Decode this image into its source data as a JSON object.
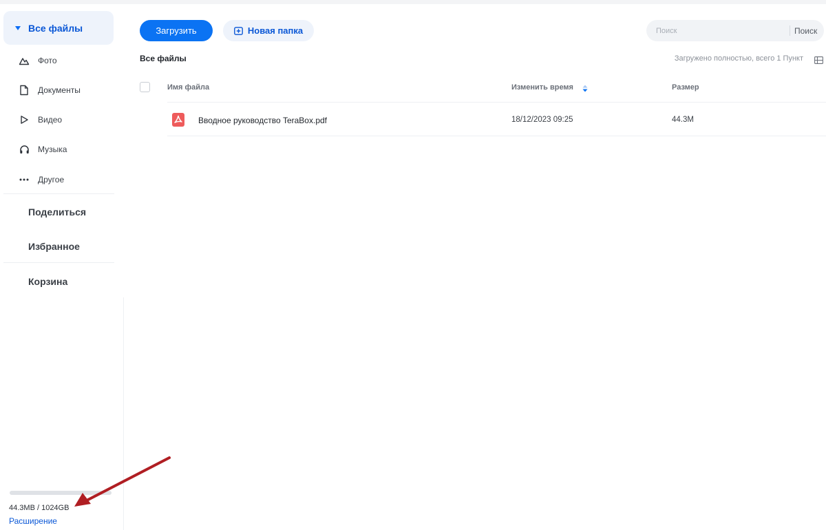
{
  "sidebar": {
    "active_item": "Все файлы",
    "sub_items": [
      {
        "label": "Фото",
        "icon": "mountain-photo-icon"
      },
      {
        "label": "Документы",
        "icon": "document-icon"
      },
      {
        "label": "Видео",
        "icon": "play-icon"
      },
      {
        "label": "Музыка",
        "icon": "headphones-icon"
      },
      {
        "label": "Другое",
        "icon": "more-dots-icon"
      }
    ],
    "main_items": [
      "Поделиться",
      "Избранное",
      "Корзина"
    ],
    "storage": {
      "text": "44.3MB / 1024GB",
      "used_fraction": 4e-05
    },
    "expand_label": "Расширение"
  },
  "toolbar": {
    "upload_label": "Загрузить",
    "new_folder_label": "Новая папка",
    "search_placeholder": "Поиск",
    "search_button": "Поиск"
  },
  "breadcrumb": {
    "title": "Все файлы",
    "status": "Загружено полностью, всего 1 Пункт"
  },
  "table": {
    "columns": [
      "Имя файла",
      "Изменить время",
      "Размер"
    ],
    "rows": [
      {
        "name": "Вводное руководство TeraBox.pdf",
        "modified": "18/12/2023 09:25",
        "size": "44.3M",
        "type_icon": "pdf-file-icon"
      }
    ]
  },
  "colors": {
    "accent": "#0b73f3",
    "active_bg": "#eef3fb",
    "pdf_red": "#ee5b5b",
    "annotation_arrow": "#b01e23"
  }
}
